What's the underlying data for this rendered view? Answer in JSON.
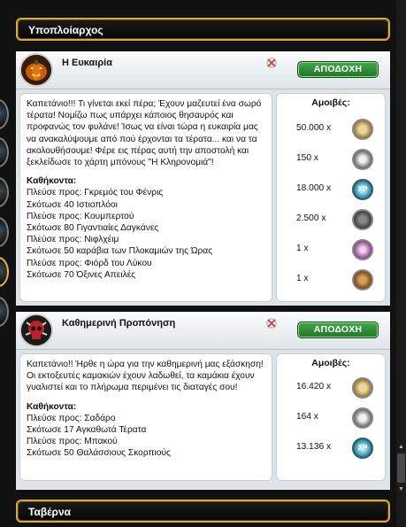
{
  "sections": {
    "lieutenant_title": "Υποπλοίαρχος",
    "tavern_title": "Ταβέρνα"
  },
  "quests": [
    {
      "title": "Η Ευκαιρία",
      "accept_label": "ΑΠΟΔΟΧΗ",
      "description": "Καπετάνιο!!! Τι γίνεται εκεί πέρα; Έχουν μαζευτεί ένα σωρό τέρατα! Νομίζω πως υπάρχει κάποιος θησαυρός και προφανώς τον φυλάνε! Ίσως να είναι τώρα η ευκαιρία μας να ανακαλύψουμε από πού έρχονται τα τέρατα... και να τα ακολουθήσουμε! Φέρε εις πέρας αυτή την αποστολή και ξεκλείδωσε το χάρτη μπόνους \"Η Κληρονομιά\"!",
      "tasks_title": "Καθήκοντα:",
      "tasks": [
        "Πλεύσε προς: Γκρεμός του Φένρις",
        "Σκότωσε 40 Ιστιοπλόοι",
        "Πλεύσε προς: Κουμπερτού",
        "Σκότωσε 80 Γιγαντιαίες Δαγκάνες",
        "Πλεύσε προς: Νιφλχέιμ",
        "Σκότωσε 50 καράβια των Πλοκαμιών της Ώρας",
        "Πλεύσε προς: Φιόρδ του Λύκου",
        "Σκότωσε 70 Όξινες Απειλές"
      ],
      "rewards_title": "Αμοιβές:",
      "rewards": [
        {
          "amount": "50.000 x",
          "icon": "gold-coin-icon"
        },
        {
          "amount": "150 x",
          "icon": "uridium-icon"
        },
        {
          "amount": "18.000 x",
          "icon": "xp-icon"
        },
        {
          "amount": "2.500 x",
          "icon": "ammo-crate-icon"
        },
        {
          "amount": "1 x",
          "icon": "purple-gem-icon"
        },
        {
          "amount": "1 x",
          "icon": "treasure-map-icon"
        }
      ]
    },
    {
      "title": "Καθημερινή Προπόνηση",
      "accept_label": "ΑΠΟΔΟΧΗ",
      "description": "Καπετάνιο!! Ήρθε η ώρα για την καθημερινή μας εξάσκηση! Οι εκτοξευτές καμακιών έχουν λαδωθεί, τα καμάκια έχουν γυαλιστεί και το πλήρωμα περιμένει τις διαταγές σου!",
      "tasks_title": "Καθήκοντα:",
      "tasks": [
        "Πλεύσε προς: Σαδάρο",
        "Σκότωσε 17 Αγκαθωτά Τέρατα",
        "Πλεύσε προς: Μπακού",
        "Σκότωσε 50 Θαλάσσιους Σκορπιούς"
      ],
      "rewards_title": "Αμοιβές:",
      "rewards": [
        {
          "amount": "16.420 x",
          "icon": "gold-coin-icon"
        },
        {
          "amount": "164 x",
          "icon": "uridium-icon"
        },
        {
          "amount": "13.136 x",
          "icon": "xp-icon"
        }
      ]
    }
  ],
  "colors": {
    "accept_green": "#2f9137",
    "header_gold": "#d8a93b"
  }
}
